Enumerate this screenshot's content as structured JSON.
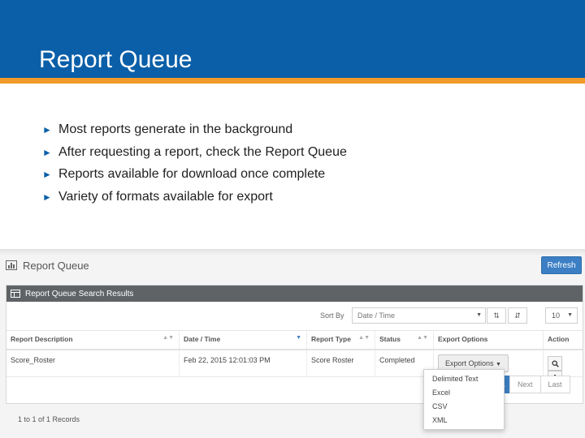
{
  "slide": {
    "title": "Report Queue",
    "bullets": [
      "Most reports generate in the background",
      "After requesting a report, check the Report Queue",
      "Reports available for download once complete",
      "Variety of formats available for export"
    ],
    "bullet_color": "#0a5fa8",
    "header_color": "#0a5fa8",
    "accent_color": "#f39b2a"
  },
  "app": {
    "page_title": "Report Queue",
    "refresh_label": "Refresh",
    "panel_title": "Report Queue Search Results",
    "sort_by_label": "Sort By",
    "sort_by_value": "Date / Time",
    "page_size": "10",
    "columns": [
      "Report Description",
      "Date / Time",
      "Report Type",
      "Status",
      "Export Options",
      "Action"
    ],
    "rows": [
      {
        "description": "Score_Roster",
        "date_time": "Feb 22, 2015 12:01:03 PM",
        "report_type": "Score Roster",
        "status": "Completed",
        "export_label": "Export Options"
      }
    ],
    "records_text": "1 to 1 of 1 Records",
    "pagination": {
      "current": "1",
      "next": "Next",
      "last": "Last"
    },
    "export_options": [
      "Delimited Text",
      "Excel",
      "CSV",
      "XML"
    ],
    "primary_color": "#3c7fc4"
  }
}
